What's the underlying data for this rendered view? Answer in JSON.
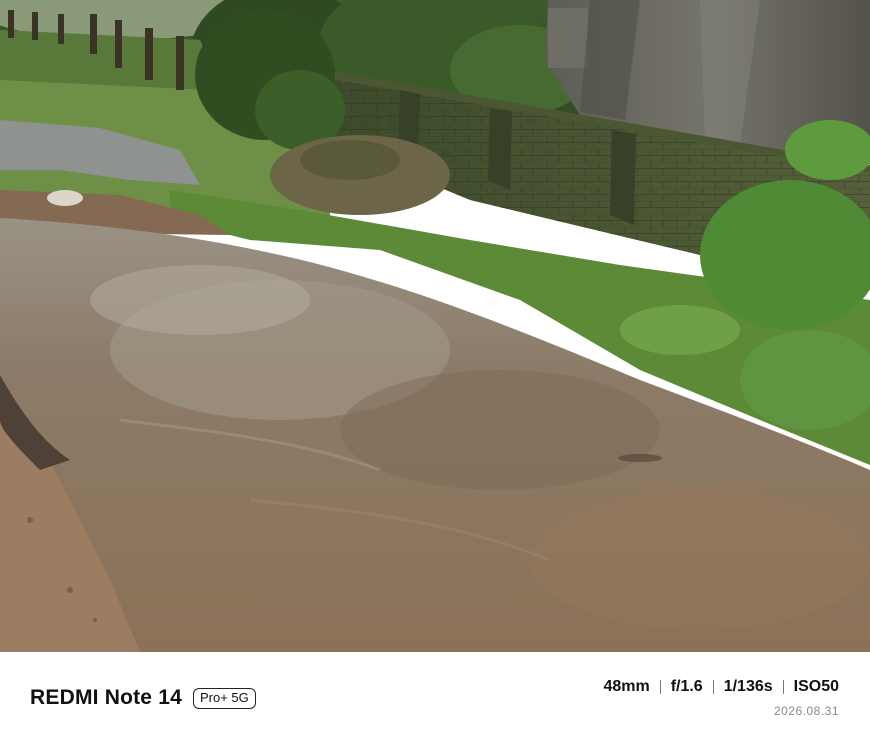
{
  "photo": {
    "subject": "muddy-puddle-road-scene",
    "colors": {
      "water": "#8a7a68",
      "wall": "#4a5634",
      "grass": "#5f8d3a",
      "concrete": "#6b6a62",
      "soil": "#9c7d62"
    }
  },
  "watermark": {
    "model": "REDMI Note 14",
    "badge": "Pro+ 5G",
    "specs": [
      "48mm",
      "f/1.6",
      "1/136s",
      "ISO50"
    ],
    "date": "2026.08.31"
  }
}
